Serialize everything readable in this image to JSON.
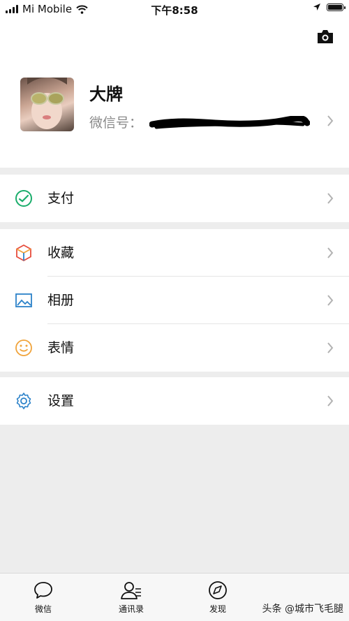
{
  "status_bar": {
    "carrier": "Mi Mobile",
    "time": "下午8:58"
  },
  "profile": {
    "name": "大牌",
    "wechat_id_label": "微信号："
  },
  "menu": {
    "pay": "支付",
    "favorites": "收藏",
    "album": "相册",
    "stickers": "表情",
    "settings": "设置"
  },
  "tabs": [
    {
      "label": "微信",
      "icon": "chat-icon"
    },
    {
      "label": "通讯录",
      "icon": "contacts-icon"
    },
    {
      "label": "发现",
      "icon": "compass-icon"
    }
  ],
  "watermark": "头条 @城市飞毛腿",
  "colors": {
    "pay": "#1aad6b",
    "settings": "#2c82c9",
    "album": "#2c82c9",
    "stickers": "#f0a33a"
  }
}
